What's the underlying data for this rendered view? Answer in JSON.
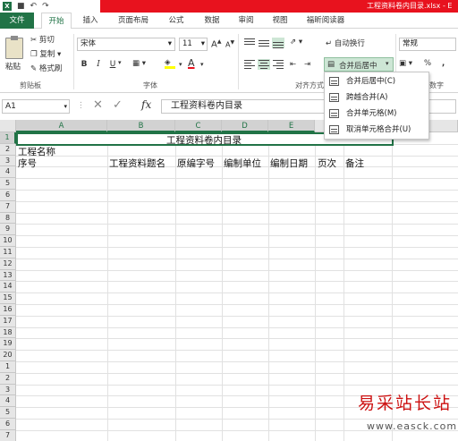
{
  "window": {
    "title": "工程资料卷内目录.xlsx - E"
  },
  "quick_access": {
    "app_icon": "X",
    "save_icon": "save-icon",
    "undo_icon": "undo-icon",
    "redo_icon": "redo-icon"
  },
  "ribbon_tabs": [
    "文件",
    "开始",
    "插入",
    "页面布局",
    "公式",
    "数据",
    "审阅",
    "视图",
    "福昕阅读器"
  ],
  "clipboard": {
    "paste": "粘贴",
    "cut": "剪切",
    "copy": "复制",
    "format_painter": "格式刷",
    "group": "剪贴板"
  },
  "font": {
    "name": "宋体",
    "size": "11",
    "grow": "A",
    "shrink": "A",
    "bold": "B",
    "italic": "I",
    "underline": "U",
    "color_letter": "A",
    "font_color": "#e8121e",
    "fill_color": "#ffff00",
    "group": "字体"
  },
  "alignment": {
    "wrap_text": "自动换行",
    "merge_center": "合并后居中",
    "group": "对齐方式"
  },
  "number": {
    "format": "常规",
    "percent": "%",
    "comma": ",",
    "group": "数字"
  },
  "formula_bar": {
    "name_box": "A1",
    "fx": "fx",
    "content": "工程资料卷内目录"
  },
  "merge_menu": [
    {
      "label": "合并后居中(C)",
      "icon": "merge-center-icon"
    },
    {
      "label": "跨越合并(A)",
      "icon": "merge-across-icon"
    },
    {
      "label": "合并单元格(M)",
      "icon": "merge-cells-icon"
    },
    {
      "label": "取消单元格合并(U)",
      "icon": "unmerge-cells-icon"
    }
  ],
  "sheet": {
    "columns": [
      "A",
      "B",
      "C",
      "D",
      "E"
    ],
    "rows": [
      "1",
      "2",
      "3",
      "4",
      "5",
      "6",
      "7",
      "8",
      "9",
      "10",
      "11",
      "12",
      "13",
      "14",
      "15",
      "16",
      "17",
      "18",
      "19",
      "20",
      "1",
      "2",
      "3",
      "4",
      "5",
      "6",
      "7"
    ],
    "cells": {
      "title": "工程资料卷内目录",
      "project_name": "工程名称",
      "headers": [
        "序号",
        "工程资料题名",
        "原编字号",
        "编制单位",
        "编制日期",
        "页次",
        "备注"
      ]
    }
  },
  "watermark": {
    "text": "易采站长站",
    "url": "www.easck.com"
  },
  "accent_color": "#217346"
}
